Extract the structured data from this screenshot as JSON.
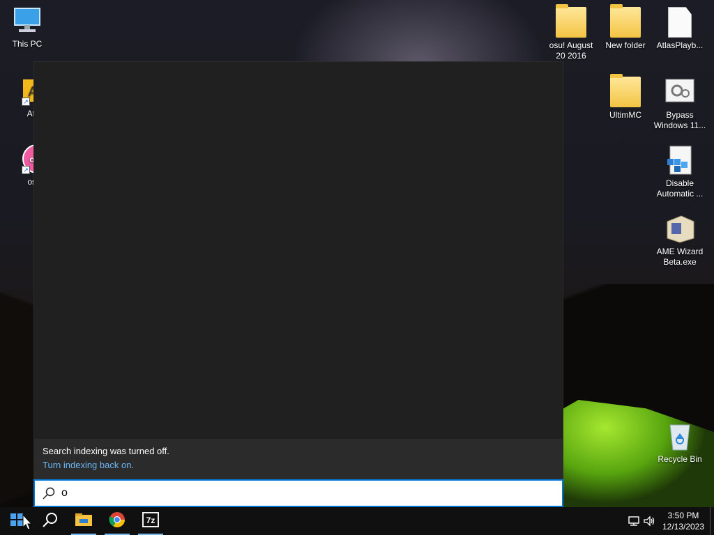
{
  "desktop": {
    "icons_left": [
      {
        "label": "This PC",
        "icon": "computer-icon"
      },
      {
        "label": "Atla",
        "icon": "atlas-shortcut-icon"
      },
      {
        "label": "osu",
        "icon": "osu-shortcut-icon"
      }
    ],
    "icons_right": [
      {
        "label": "osu! August 20 2016",
        "icon": "folder-icon"
      },
      {
        "label": "New folder",
        "icon": "folder-icon"
      },
      {
        "label": "AtlasPlayb...",
        "icon": "document-icon"
      },
      {
        "label": "UltimMC",
        "icon": "folder-icon"
      },
      {
        "label": "Bypass Windows 11...",
        "icon": "settings-file-icon"
      },
      {
        "label": "Disable Automatic ...",
        "icon": "script-file-icon"
      },
      {
        "label": "AME Wizard Beta.exe",
        "icon": "installer-icon"
      },
      {
        "label": "Recycle Bin",
        "icon": "recycle-bin-icon"
      }
    ]
  },
  "search": {
    "notice_title": "Search indexing was turned off.",
    "notice_link": "Turn indexing back on.",
    "query": "o"
  },
  "taskbar": {
    "start": "windows-logo-icon",
    "apps": [
      "search-icon",
      "file-explorer-icon",
      "chrome-icon",
      "7zip-icon"
    ],
    "tray_icons": [
      "network-icon",
      "volume-icon"
    ],
    "time": "3:50 PM",
    "date": "12/13/2023"
  },
  "colors": {
    "accent": "#0078d7",
    "link": "#6cb8f6",
    "panel": "#202020",
    "taskbar": "#101010"
  }
}
